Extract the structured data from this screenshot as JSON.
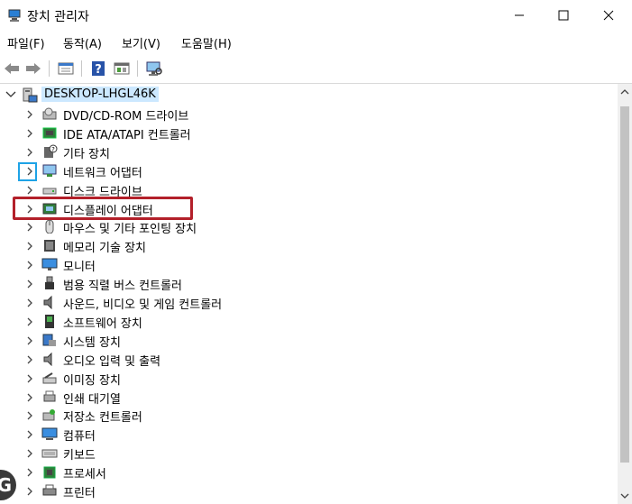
{
  "window": {
    "title": "장치 관리자"
  },
  "menu": [
    "파일(F)",
    "동작(A)",
    "보기(V)",
    "도움말(H)"
  ],
  "tree": {
    "root": "DESKTOP-LHGL46K",
    "items": [
      {
        "label": "DVD/CD-ROM 드라이브",
        "icon": "dvd-drive-icon"
      },
      {
        "label": "IDE ATA/ATAPI 컨트롤러",
        "icon": "ide-controller-icon"
      },
      {
        "label": "기타 장치",
        "icon": "unknown-device-icon"
      },
      {
        "label": "네트워크 어댑터",
        "icon": "network-adapter-icon"
      },
      {
        "label": "디스크 드라이브",
        "icon": "disk-drive-icon"
      },
      {
        "label": "디스플레이 어댑터",
        "icon": "display-adapter-icon"
      },
      {
        "label": "마우스 및 기타 포인팅 장치",
        "icon": "mouse-icon"
      },
      {
        "label": "메모리 기술 장치",
        "icon": "memory-device-icon"
      },
      {
        "label": "모니터",
        "icon": "monitor-icon"
      },
      {
        "label": "범용 직렬 버스 컨트롤러",
        "icon": "usb-icon"
      },
      {
        "label": "사운드, 비디오 및 게임 컨트롤러",
        "icon": "sound-icon"
      },
      {
        "label": "소프트웨어 장치",
        "icon": "software-device-icon"
      },
      {
        "label": "시스템 장치",
        "icon": "system-device-icon"
      },
      {
        "label": "오디오 입력 및 출력",
        "icon": "audio-io-icon"
      },
      {
        "label": "이미징 장치",
        "icon": "imaging-device-icon"
      },
      {
        "label": "인쇄 대기열",
        "icon": "print-queue-icon"
      },
      {
        "label": "저장소 컨트롤러",
        "icon": "storage-controller-icon"
      },
      {
        "label": "컴퓨터",
        "icon": "computer-icon"
      },
      {
        "label": "키보드",
        "icon": "keyboard-icon"
      },
      {
        "label": "프로세서",
        "icon": "processor-icon"
      },
      {
        "label": "프린터",
        "icon": "printer-icon"
      }
    ]
  },
  "colors": {
    "focus_outline": "#1ea3e6",
    "highlight_outline": "#b3202a",
    "selection": "#cce8ff"
  },
  "badge": "G"
}
